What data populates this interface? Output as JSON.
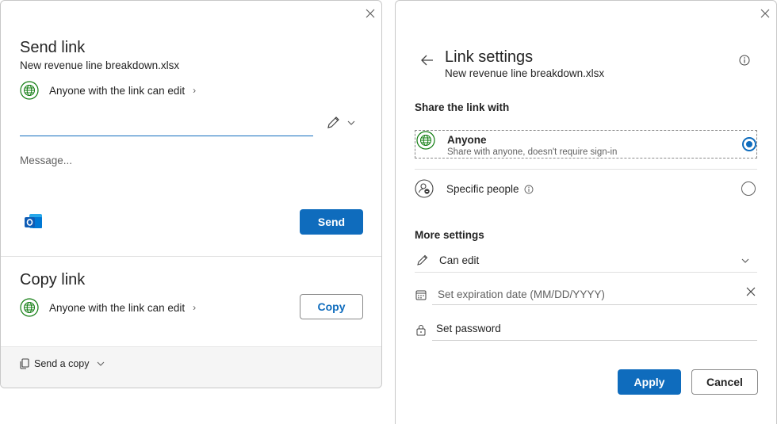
{
  "send_dialog": {
    "title": "Send link",
    "filename": "New revenue line breakdown.xlsx",
    "permission": "Anyone with the link can edit",
    "message_placeholder": "Message...",
    "send_label": "Send"
  },
  "copy_section": {
    "title": "Copy link",
    "permission": "Anyone with the link can edit",
    "copy_label": "Copy"
  },
  "footer": {
    "send_copy_label": "Send a copy"
  },
  "settings_dialog": {
    "title": "Link settings",
    "filename": "New revenue line breakdown.xlsx",
    "share_with_heading": "Share the link with",
    "options": [
      {
        "label": "Anyone",
        "description": "Share with anyone, doesn't require sign-in",
        "selected": true
      },
      {
        "label": "Specific people",
        "selected": false
      }
    ],
    "more_settings_heading": "More settings",
    "edit_permission": "Can edit",
    "expiration_placeholder": "Set expiration date (MM/DD/YYYY)",
    "password_label": "Set password",
    "apply_label": "Apply",
    "cancel_label": "Cancel"
  },
  "colors": {
    "accent": "#0f6cbd",
    "globe_green": "#107c10"
  }
}
